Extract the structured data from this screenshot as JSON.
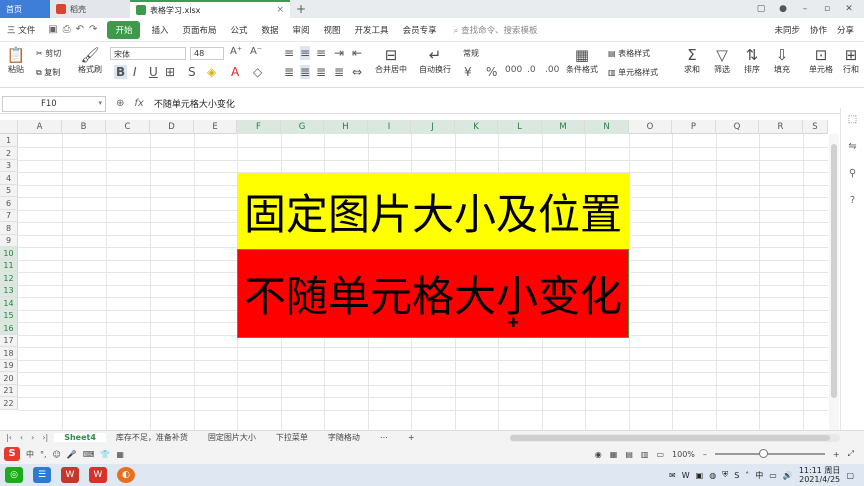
{
  "titlebar": {
    "tabs": [
      {
        "label": "首页"
      },
      {
        "label": "稻壳"
      },
      {
        "label": "表格学习.xlsx"
      }
    ],
    "add_tab": "+",
    "close_glyph": "×"
  },
  "menubar": {
    "file": "三 文件",
    "start": "开始",
    "items": [
      "插入",
      "页面布局",
      "公式",
      "数据",
      "审阅",
      "视图",
      "开发工具",
      "会员专享"
    ],
    "search": "查找命令、搜索模板",
    "right": [
      "未同步",
      "协作",
      "分享"
    ]
  },
  "ribbon": {
    "paste": "粘贴",
    "cut": "剪切",
    "copy": "复制",
    "format_painter": "格式刷",
    "font_name": "宋体",
    "font_size": "48",
    "merge_center": "合并居中",
    "wrap_text": "自动换行",
    "number_format": "常规",
    "conditional_format": "条件格式",
    "table_style": "表格样式",
    "cell_style": "单元格样式",
    "sum": "求和",
    "filter": "筛选",
    "sort": "排序",
    "fill": "填充",
    "cell": "单元格",
    "rowcol": "行和"
  },
  "formula_bar": {
    "cell_ref": "F10",
    "content": "不随单元格大小变化"
  },
  "grid": {
    "columns": [
      "A",
      "B",
      "C",
      "D",
      "E",
      "F",
      "G",
      "H",
      "I",
      "J",
      "K",
      "L",
      "M",
      "N",
      "O",
      "P",
      "Q",
      "R",
      "S"
    ],
    "rows": [
      "1",
      "2",
      "3",
      "4",
      "5",
      "6",
      "7",
      "8",
      "9",
      "10",
      "11",
      "12",
      "13",
      "14",
      "15",
      "16",
      "17",
      "18",
      "19",
      "20",
      "21",
      "22"
    ],
    "picture_top_text": "固定图片大小及位置",
    "picture_bottom_text": "不随单元格大小变化",
    "colors": {
      "yellow": "#ffff00",
      "red": "#ff0000",
      "selection": "#2c7a45"
    }
  },
  "sheets": {
    "tabs": [
      "Sheet4",
      "库存不足，准备补货",
      "固定图片大小",
      "下拉菜单",
      "字随格动"
    ],
    "more": "⋯",
    "add": "+"
  },
  "statusbar": {
    "ime": "中",
    "zoom": "100%"
  },
  "taskbar": {
    "ime": "中",
    "time": "11:11 周日",
    "date": "2021/4/25"
  }
}
